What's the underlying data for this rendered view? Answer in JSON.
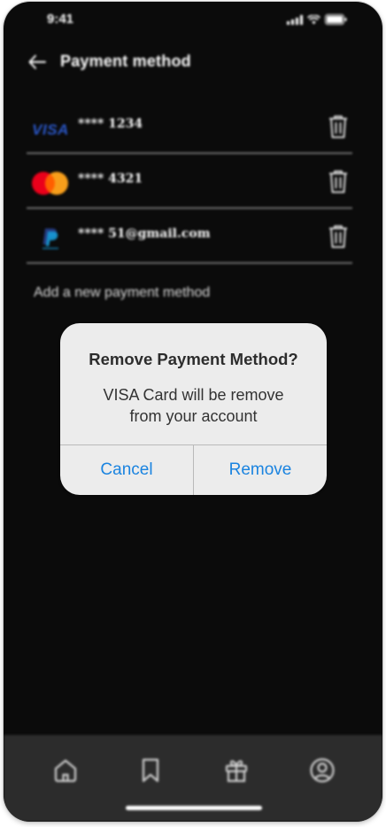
{
  "status_bar": {
    "time": "9:41",
    "icons": [
      "signal-icon",
      "wifi-icon",
      "battery-icon"
    ]
  },
  "header": {
    "title": "Payment method",
    "back_icon": "back-arrow-icon"
  },
  "payment_methods": [
    {
      "logo": "VISA",
      "label": "**** 1234",
      "brand": "visa"
    },
    {
      "logo": "",
      "label": "**** 4321",
      "brand": "mastercard"
    },
    {
      "logo": "",
      "label": "**** 51@gmail.com",
      "brand": "paypal"
    }
  ],
  "add_method_label": "Add a new payment method",
  "dialog": {
    "title": "Remove Payment Method?",
    "message": "VISA Card will be remove from your account",
    "cancel_label": "Cancel",
    "remove_label": "Remove"
  },
  "tabbar": {
    "items": [
      "home-icon",
      "bookmark-icon",
      "gift-icon",
      "profile-icon"
    ]
  },
  "colors": {
    "background": "#0b0b0b",
    "tabbar": "#2c2c2c",
    "dialog": "#ececec",
    "accent": "#1b84e0",
    "visa_blue": "#2a57c8",
    "mastercard_red": "#eb001b",
    "mastercard_orange": "#f79e1b",
    "paypal_blue": "#253b80"
  }
}
